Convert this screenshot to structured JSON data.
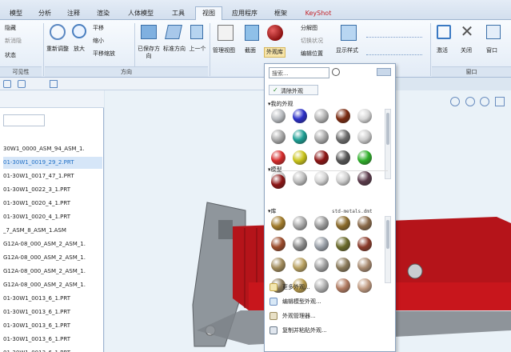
{
  "menu_tabs": [
    "模型",
    "分析",
    "注释",
    "渲染",
    "人体模型",
    "工具",
    "视图",
    "应用程序",
    "框架",
    "KeyShot"
  ],
  "active_tab": "视图",
  "ribbon": {
    "left_items": [
      "隐藏",
      "新消隐",
      "状态"
    ],
    "left_group_label": "可见性",
    "zoom_buttons": [
      "重新调整",
      "放大"
    ],
    "pan_items": [
      "平移",
      "缩小",
      "平移缩放"
    ],
    "orient_buttons": [
      "已保存方向",
      "标准方向",
      "上一个"
    ],
    "orient_group_label": "方向",
    "manage_buttons": [
      "管理视图",
      "截面",
      "外观库"
    ],
    "display_items": [
      "分解图",
      "切换状况",
      "编辑位置"
    ],
    "display_style": "显示样式",
    "window_buttons": [
      "激活",
      "关闭",
      "窗口"
    ],
    "window_group_label": "窗口"
  },
  "appearance_panel": {
    "search_placeholder": "搜索...",
    "clear_label": "清除外观",
    "my_appearances_label": "▾我的外观",
    "model_label": "▾模型",
    "library_label": "▾库",
    "library_file": "std-metals.dmt",
    "my_balls": [
      "#b9bcc0",
      "#2a2ec6",
      "#b3b3b3",
      "#7a2a10",
      "#d6d6d6",
      "#a8a8a8",
      "#1c9e93",
      "#a9a9a9",
      "#6b6b6b",
      "#cccccc",
      "#d42a2a",
      "#c9c31a",
      "#8b1414",
      "#555555",
      "#2fae2a",
      "#c8c8c8",
      "#bfbfbf",
      "#d4d4d4",
      "#d0d0d0",
      "#5a3a4a"
    ],
    "model_balls": [
      "#8b1414"
    ],
    "library_balls": [
      "#a07a2a",
      "#a8a8a8",
      "#9a9a9a",
      "#8a6a2a",
      "#8a6a4a",
      "#9a4a2a",
      "#8a8a8a",
      "#9aa0a8",
      "#6a6a2a",
      "#8a3a2a",
      "#a08a5a",
      "#b8a060",
      "#a0a0a0",
      "#8a7a5a",
      "#a88a70",
      "#8a7a5a",
      "#b89a4a",
      "#b0b0b0",
      "#b07a60",
      "#c09a80"
    ],
    "menu_items": [
      "更多外观...",
      "编辑模型外观...",
      "外观管理器...",
      "复制并粘贴外观..."
    ]
  },
  "tree_items": [
    "30W1_0000_ASM_94_ASM_1.",
    "01-30W1_0019_29_2.PRT",
    "01-30W1_0017_47_1.PRT",
    "01-30W1_0022_3_1.PRT",
    "01-30W1_0020_4_1.PRT",
    "01-30W1_0020_4_1.PRT",
    "_7_ASM_8_ASM_1.ASM",
    "G12A-08_000_ASM_2_ASM_1.",
    "G12A-08_000_ASM_2_ASM_1.",
    "G12A-08_000_ASM_2_ASM_1.",
    "G12A-08_000_ASM_2_ASM_1.",
    "01-30W1_0013_6_1.PRT",
    "01-30W1_0013_6_1.PRT",
    "01-30W1_0013_6_1.PRT",
    "01-30W1_0013_6_1.PRT",
    "01-30W1_0013_6_1.PRT"
  ],
  "selected_tree_index": 1,
  "colors": {
    "part_red": "#b5141a",
    "bracket_gray": "#8f969c",
    "accent_blue": "#2b6cc4"
  }
}
